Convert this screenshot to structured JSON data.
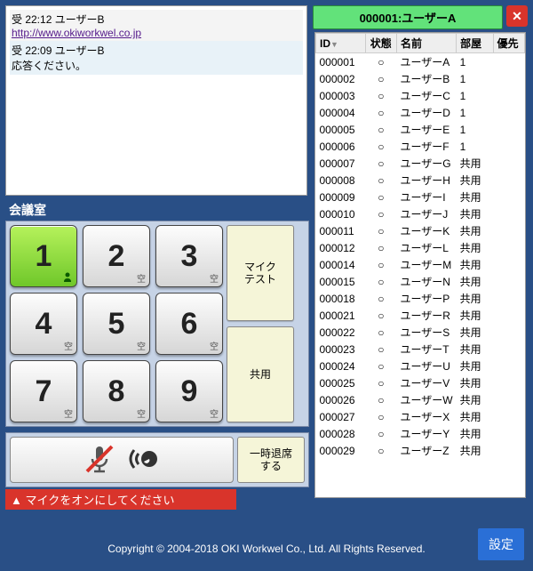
{
  "chat": {
    "msg1_header": "受 22:12 ユーザーB",
    "msg1_link": "http://www.okiworkwel.co.jp",
    "msg2_header": "受 22:09 ユーザーB",
    "msg2_body": "応答ください。"
  },
  "selected_user": "000001:ユーザーA",
  "section_title": "会議室",
  "userlist": {
    "headers": {
      "id": "ID",
      "status": "状態",
      "name": "名前",
      "room": "部屋",
      "priority": "優先"
    },
    "rows": [
      {
        "id": "000001",
        "status": "○",
        "name": "ユーザーA",
        "room": "1"
      },
      {
        "id": "000002",
        "status": "○",
        "name": "ユーザーB",
        "room": "1"
      },
      {
        "id": "000003",
        "status": "○",
        "name": "ユーザーC",
        "room": "1"
      },
      {
        "id": "000004",
        "status": "○",
        "name": "ユーザーD",
        "room": "1"
      },
      {
        "id": "000005",
        "status": "○",
        "name": "ユーザーE",
        "room": "1"
      },
      {
        "id": "000006",
        "status": "○",
        "name": "ユーザーF",
        "room": "1"
      },
      {
        "id": "000007",
        "status": "○",
        "name": "ユーザーG",
        "room": "共用"
      },
      {
        "id": "000008",
        "status": "○",
        "name": "ユーザーH",
        "room": "共用"
      },
      {
        "id": "000009",
        "status": "○",
        "name": "ユーザーI",
        "room": "共用"
      },
      {
        "id": "000010",
        "status": "○",
        "name": "ユーザーJ",
        "room": "共用"
      },
      {
        "id": "000011",
        "status": "○",
        "name": "ユーザーK",
        "room": "共用"
      },
      {
        "id": "000012",
        "status": "○",
        "name": "ユーザーL",
        "room": "共用"
      },
      {
        "id": "000014",
        "status": "○",
        "name": "ユーザーM",
        "room": "共用"
      },
      {
        "id": "000015",
        "status": "○",
        "name": "ユーザーN",
        "room": "共用"
      },
      {
        "id": "000018",
        "status": "○",
        "name": "ユーザーP",
        "room": "共用"
      },
      {
        "id": "000021",
        "status": "○",
        "name": "ユーザーR",
        "room": "共用"
      },
      {
        "id": "000022",
        "status": "○",
        "name": "ユーザーS",
        "room": "共用"
      },
      {
        "id": "000023",
        "status": "○",
        "name": "ユーザーT",
        "room": "共用"
      },
      {
        "id": "000024",
        "status": "○",
        "name": "ユーザーU",
        "room": "共用"
      },
      {
        "id": "000025",
        "status": "○",
        "name": "ユーザーV",
        "room": "共用"
      },
      {
        "id": "000026",
        "status": "○",
        "name": "ユーザーW",
        "room": "共用"
      },
      {
        "id": "000027",
        "status": "○",
        "name": "ユーザーX",
        "room": "共用"
      },
      {
        "id": "000028",
        "status": "○",
        "name": "ユーザーY",
        "room": "共用"
      },
      {
        "id": "000029",
        "status": "○",
        "name": "ユーザーZ",
        "room": "共用"
      }
    ]
  },
  "keypad": {
    "vacant_label": "空",
    "occupied_icon": "user"
  },
  "buttons": {
    "mic_test": "マイク\nテスト",
    "shared": "共用",
    "leave": "一時退席\nする",
    "close": "✕",
    "settings": "設定"
  },
  "warning": "マイクをオンにしてください",
  "copyright": "Copyright © 2004-2018 OKI Workwel Co., Ltd. All Rights Reserved."
}
